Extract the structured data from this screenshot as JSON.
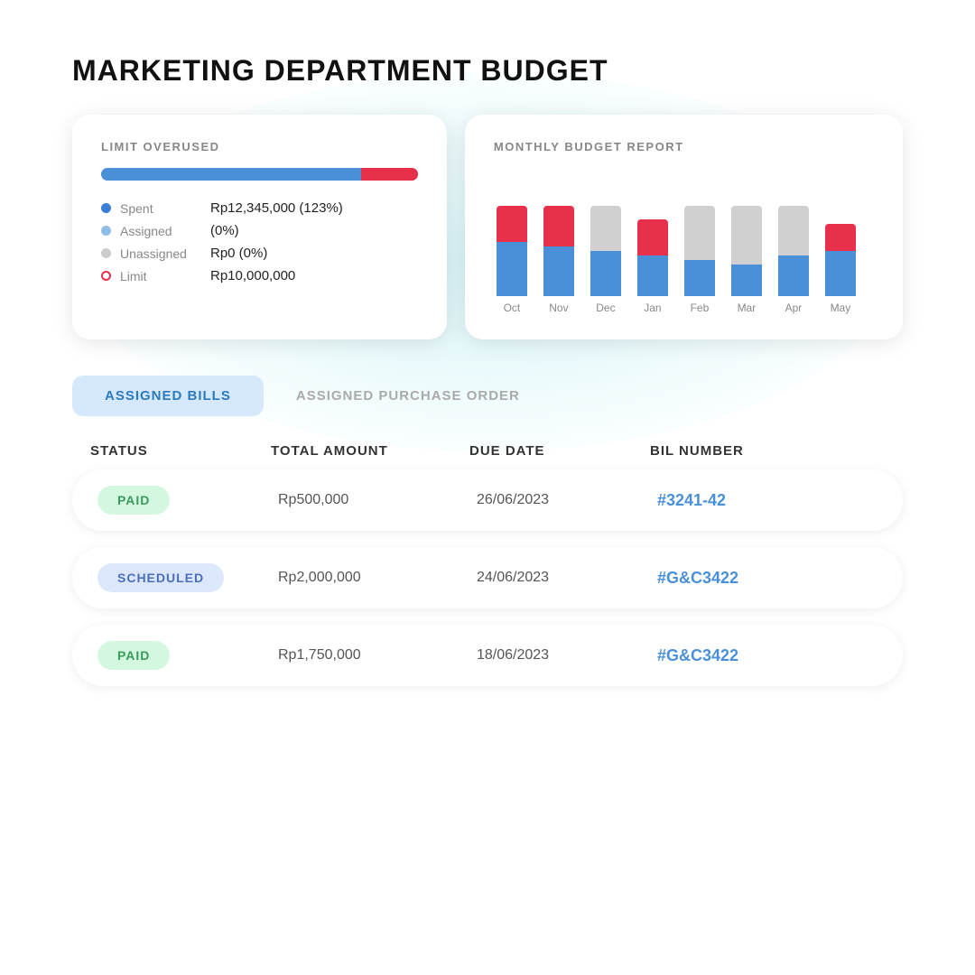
{
  "page": {
    "title": "MARKETING DEPARTMENT BUDGET"
  },
  "limit_card": {
    "label": "LIMIT OVERUSED",
    "progress_blue_pct": 82,
    "progress_red_pct": 18,
    "legend": [
      {
        "id": "spent",
        "color": "#3a7fd5",
        "label": "Spent",
        "value": "Rp12,345,000 (123%)"
      },
      {
        "id": "assigned",
        "color": "#90bce8",
        "label": "Assigned",
        "value": "(0%)"
      },
      {
        "id": "unassigned",
        "color": "#cccccc",
        "label": "Unassigned",
        "value": "Rp0 (0%)"
      },
      {
        "id": "limit",
        "color": "#e8304a",
        "label": "Limit",
        "value": "Rp10,000,000",
        "dot_type": "ring"
      }
    ]
  },
  "chart_card": {
    "label": "MONTHLY BUDGET REPORT",
    "months": [
      "Oct",
      "Nov",
      "Dec",
      "Jan",
      "Feb",
      "Mar",
      "Apr",
      "May"
    ],
    "bars": [
      {
        "month": "Oct",
        "blue": 60,
        "red": 40
      },
      {
        "month": "Nov",
        "blue": 55,
        "red": 45
      },
      {
        "month": "Dec",
        "blue": 50,
        "red": 0,
        "gray": 50
      },
      {
        "month": "Jan",
        "blue": 45,
        "red": 40
      },
      {
        "month": "Feb",
        "blue": 40,
        "red": 0,
        "gray": 60
      },
      {
        "month": "Mar",
        "blue": 35,
        "red": 0,
        "gray": 65
      },
      {
        "month": "Apr",
        "blue": 45,
        "red": 0,
        "gray": 55
      },
      {
        "month": "May",
        "blue": 50,
        "red": 30
      }
    ]
  },
  "tabs": [
    {
      "id": "assigned-bills",
      "label": "ASSIGNED BILLS",
      "active": true
    },
    {
      "id": "assigned-po",
      "label": "ASSIGNED PURCHASE ORDER",
      "active": false
    }
  ],
  "table": {
    "headers": [
      "STATUS",
      "TOTAL AMOUNT",
      "DUE DATE",
      "BIL NUMBER"
    ],
    "rows": [
      {
        "status": "PAID",
        "status_type": "paid",
        "amount": "Rp500,000",
        "due_date": "26/06/2023",
        "bill_number": "#3241-42"
      },
      {
        "status": "SCHEDULED",
        "status_type": "scheduled",
        "amount": "Rp2,000,000",
        "due_date": "24/06/2023",
        "bill_number": "#G&C3422"
      },
      {
        "status": "PAID",
        "status_type": "paid",
        "amount": "Rp1,750,000",
        "due_date": "18/06/2023",
        "bill_number": "#G&C3422"
      }
    ]
  }
}
